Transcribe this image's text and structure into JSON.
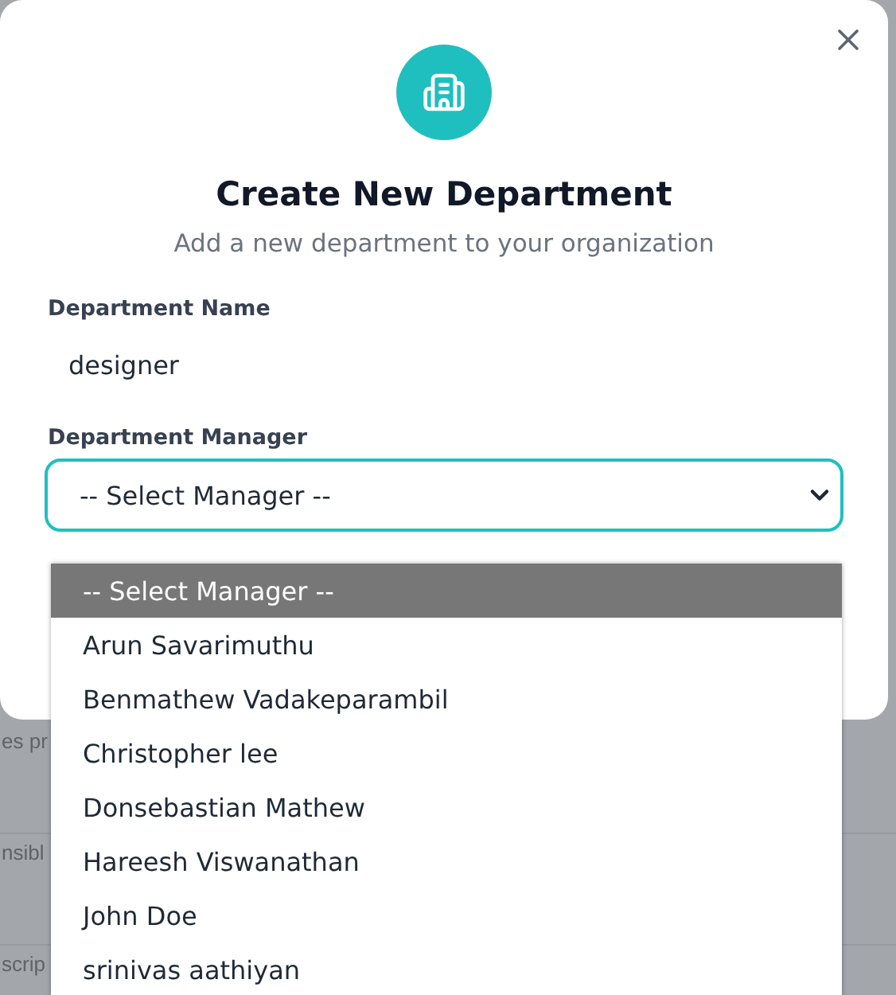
{
  "background_rows": [
    "es pr",
    "nsibl",
    "scrip"
  ],
  "dialog": {
    "title": "Create New Department",
    "subtitle": "Add a new department to your organization",
    "fields": [
      {
        "label": "Department Name",
        "value": "designer"
      }
    ],
    "manager": {
      "label": "Department Manager",
      "value": "-- Select Manager --",
      "expanded": true,
      "options": [
        {
          "label": "-- Select Manager --",
          "selected": true
        },
        {
          "label": "Arun Savarimuthu",
          "selected": false
        },
        {
          "label": "Benmathew Vadakeparambil",
          "selected": false
        },
        {
          "label": "Christopher lee",
          "selected": false
        },
        {
          "label": "Donsebastian Mathew",
          "selected": false
        },
        {
          "label": "Hareesh Viswanathan",
          "selected": false
        },
        {
          "label": "John Doe",
          "selected": false
        },
        {
          "label": "srinivas aathiyan",
          "selected": false
        }
      ]
    }
  }
}
